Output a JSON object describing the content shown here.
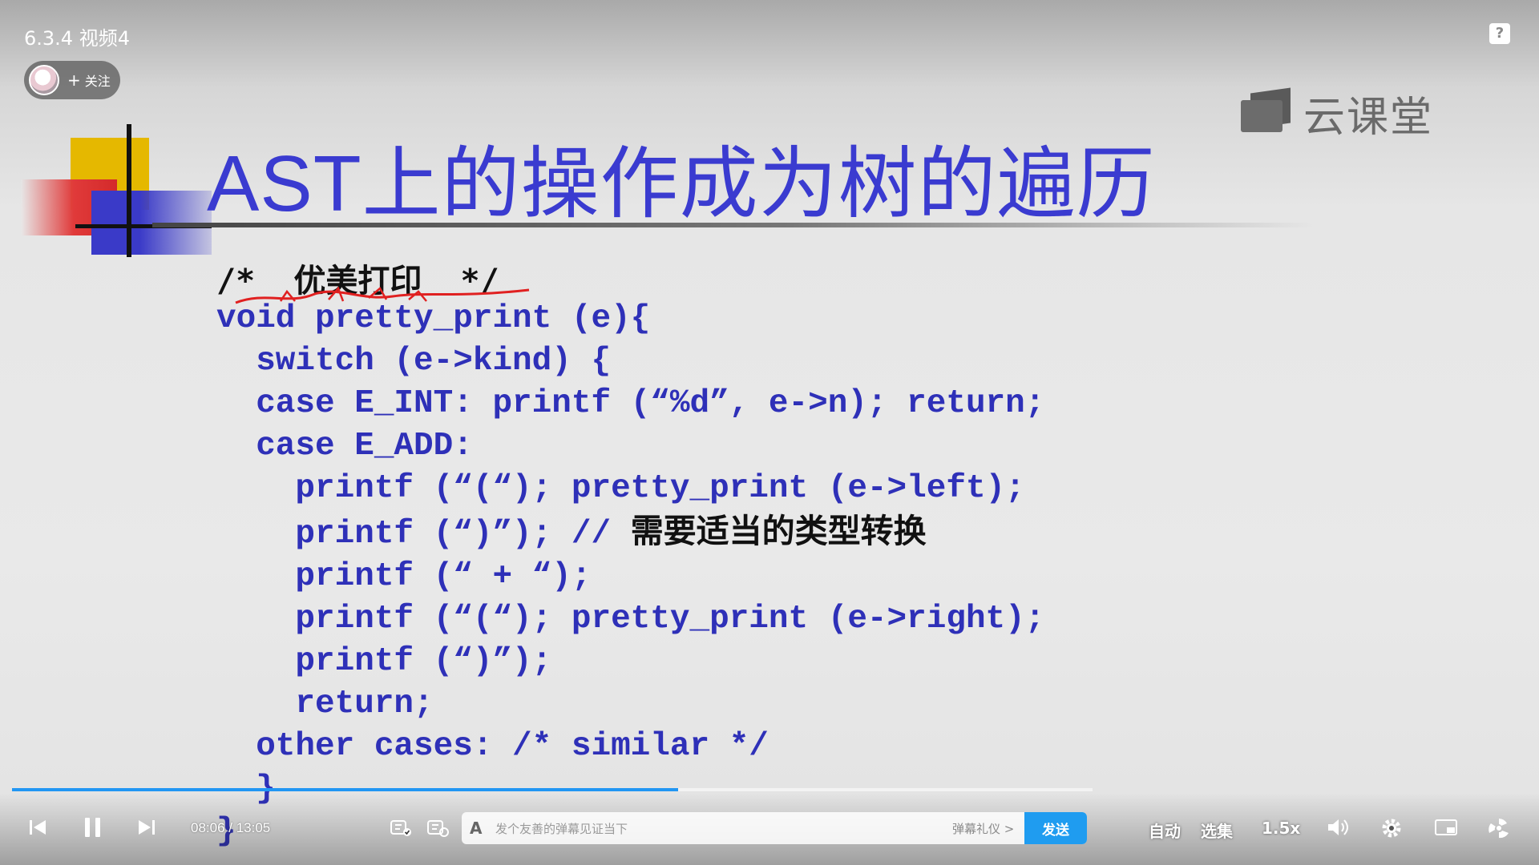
{
  "video": {
    "title": "6.3.4 视频4",
    "follow_label": "关注",
    "brand_name": "云课堂",
    "help_label": "?"
  },
  "slide": {
    "title": "AST上的操作成为树的遍历",
    "comment": "/*  优美打印  */",
    "code_lines": [
      "void pretty_print (e){",
      "  switch (e->kind) {",
      "  case E_INT: printf (“%d”, e->n); return;",
      "  case E_ADD:",
      "    printf (“(“); pretty_print (e->left);",
      "    printf (“)”); // ",
      "    printf (“ + “);",
      "    printf (“(“); pretty_print (e->right);",
      "    printf (“)”);",
      "    return;",
      "  other cases: /* similar */",
      "  }",
      "}"
    ],
    "cast_comment": "需要适当的类型转换"
  },
  "player": {
    "current_time": "08:06",
    "separator": " / ",
    "duration": "13:05",
    "progress": 0.6167,
    "danmaku_placeholder": "发个友善的弹幕见证当下",
    "danmaku_etiquette": "弹幕礼仪 >",
    "send_label": "发送",
    "auto_label": "自动",
    "episodes_label": "选集",
    "speed_label": "1.5x",
    "accent_color": "#1f9cf0"
  }
}
